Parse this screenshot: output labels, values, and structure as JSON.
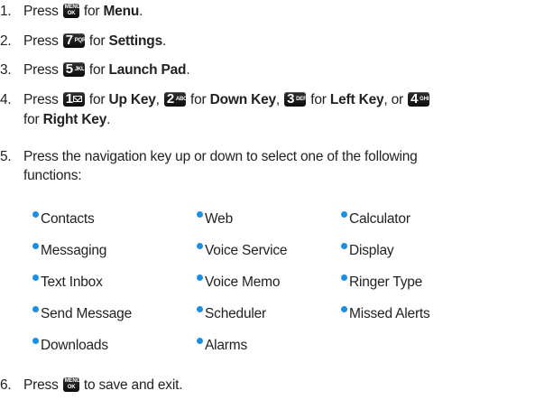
{
  "keys": {
    "menu": {
      "line1": "MENU",
      "line2": "OK"
    },
    "k7": {
      "digit": "7",
      "letters": "PQRS"
    },
    "k5": {
      "digit": "5",
      "letters": "JKL"
    },
    "k1": {
      "digit": "1"
    },
    "k2": {
      "digit": "2",
      "letters": "ABC"
    },
    "k3": {
      "digit": "3",
      "letters": "DEF"
    },
    "k4": {
      "digit": "4",
      "letters": "GHI"
    }
  },
  "steps": [
    {
      "num": "1.",
      "a": "Press",
      "b": "for",
      "c": "Menu",
      "d": "."
    },
    {
      "num": "2.",
      "a": "Press",
      "b": "for",
      "c": "Settings",
      "d": "."
    },
    {
      "num": "3.",
      "a": "Press",
      "b": "for",
      "c": "Launch Pad",
      "d": "."
    },
    {
      "num": "4.",
      "a": "Press",
      "b": "for",
      "c": "Up Key",
      "d": ",",
      "e": "for",
      "f": "Down Key",
      "g": ",",
      "h": "for",
      "i": "Left Key",
      "j": ", or",
      "k": "for",
      "l": "Right Key",
      "m": "."
    },
    {
      "num": "5.",
      "line1": "Press the navigation key up or down to select one of the following",
      "line2": "functions:"
    },
    {
      "num": "6.",
      "a": "Press",
      "b": "to save and exit."
    }
  ],
  "functions": [
    [
      "Contacts",
      "Web",
      "Calculator"
    ],
    [
      "Messaging",
      "Voice Service",
      "Display"
    ],
    [
      "Text Inbox",
      "Voice Memo",
      "Ringer Type"
    ],
    [
      "Send Message",
      "Scheduler",
      "Missed Alerts"
    ],
    [
      "Downloads",
      "Alarms"
    ]
  ],
  "colors": {
    "bullet": "#1e8fe0",
    "key": "#111111"
  }
}
